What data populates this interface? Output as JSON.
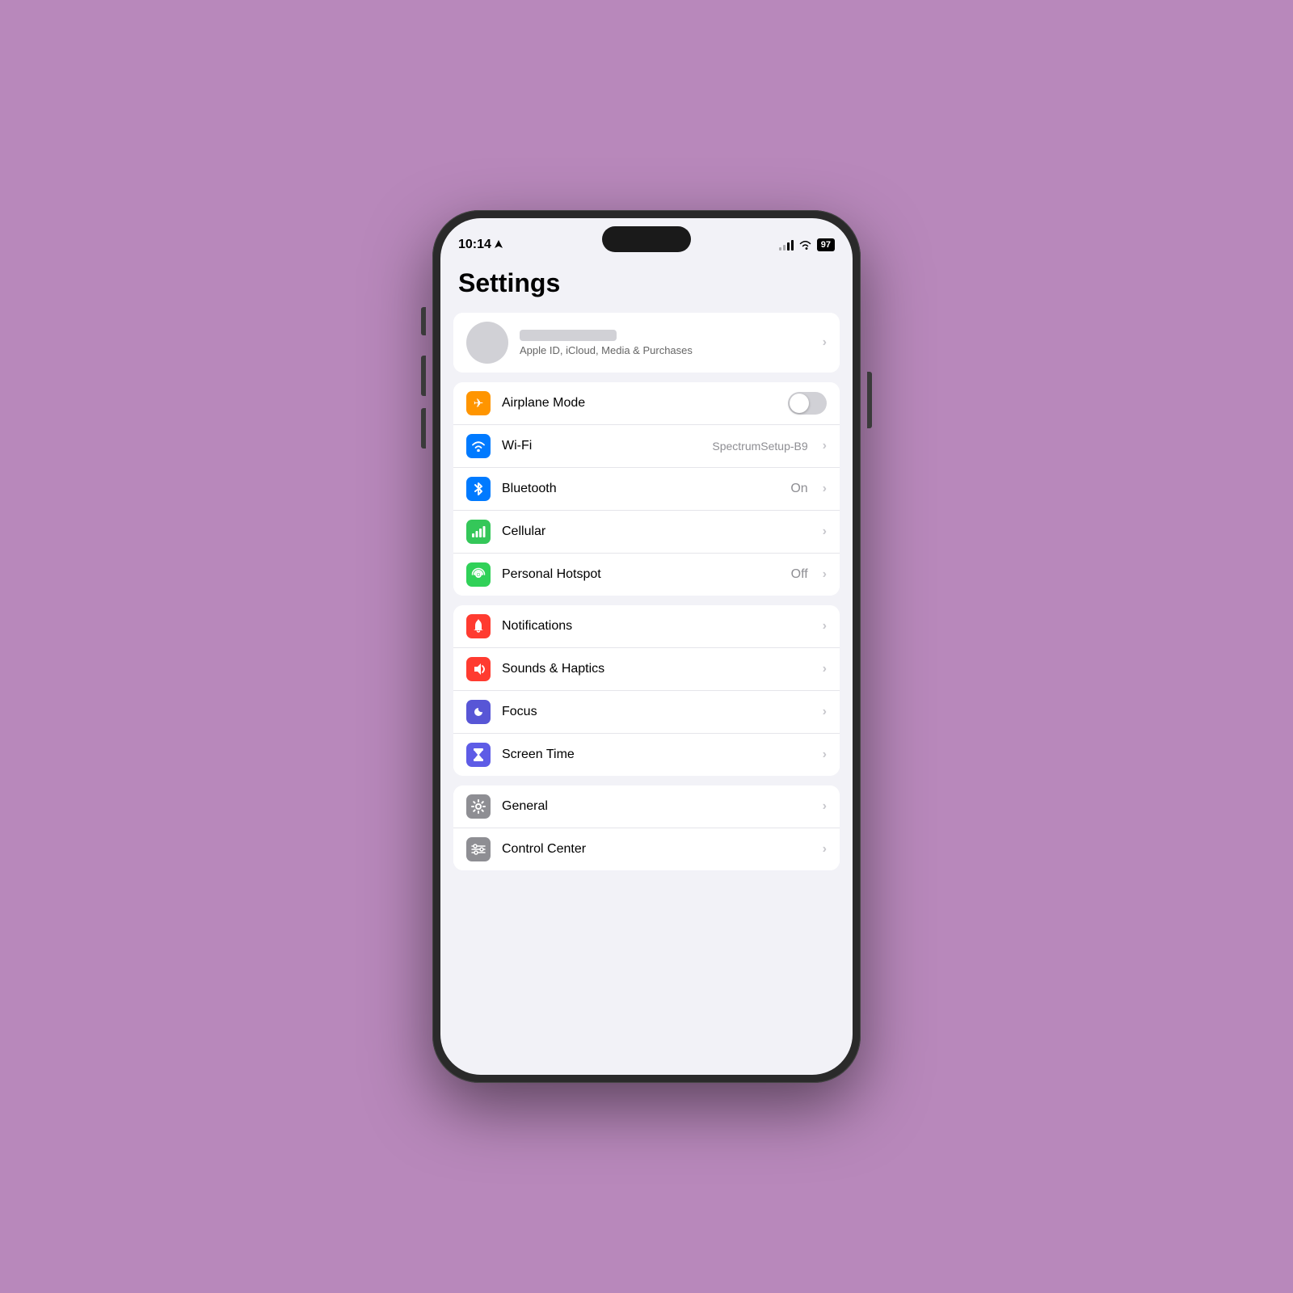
{
  "statusBar": {
    "time": "10:14",
    "battery": "97"
  },
  "title": "Settings",
  "appleId": {
    "subtitle": "Apple ID, iCloud, Media & Purchases"
  },
  "sections": [
    {
      "id": "connectivity",
      "rows": [
        {
          "id": "airplane",
          "label": "Airplane Mode",
          "icon": "✈",
          "iconClass": "icon-orange",
          "type": "toggle",
          "toggleOn": false
        },
        {
          "id": "wifi",
          "label": "Wi-Fi",
          "icon": "wifi",
          "iconClass": "icon-blue",
          "type": "value-chevron",
          "value": "SpectrumSetup-B9"
        },
        {
          "id": "bluetooth",
          "label": "Bluetooth",
          "icon": "bt",
          "iconClass": "icon-blue-light",
          "type": "value-chevron",
          "value": "On"
        },
        {
          "id": "cellular",
          "label": "Cellular",
          "icon": "cellular",
          "iconClass": "icon-green",
          "type": "chevron",
          "value": ""
        },
        {
          "id": "hotspot",
          "label": "Personal Hotspot",
          "icon": "hotspot",
          "iconClass": "icon-green2",
          "type": "value-chevron",
          "value": "Off"
        }
      ]
    },
    {
      "id": "notifications-group",
      "rows": [
        {
          "id": "notifications",
          "label": "Notifications",
          "icon": "bell",
          "iconClass": "icon-red",
          "type": "chevron"
        },
        {
          "id": "sounds",
          "label": "Sounds & Haptics",
          "icon": "sound",
          "iconClass": "icon-red2",
          "type": "chevron"
        },
        {
          "id": "focus",
          "label": "Focus",
          "icon": "moon",
          "iconClass": "icon-purple",
          "type": "chevron"
        },
        {
          "id": "screentime",
          "label": "Screen Time",
          "icon": "hourglass",
          "iconClass": "icon-purple2",
          "type": "chevron"
        }
      ]
    },
    {
      "id": "general-group",
      "rows": [
        {
          "id": "general",
          "label": "General",
          "icon": "gear",
          "iconClass": "icon-gray",
          "type": "chevron"
        },
        {
          "id": "controlcenter",
          "label": "Control Center",
          "icon": "sliders",
          "iconClass": "icon-gray",
          "type": "chevron"
        }
      ]
    }
  ]
}
